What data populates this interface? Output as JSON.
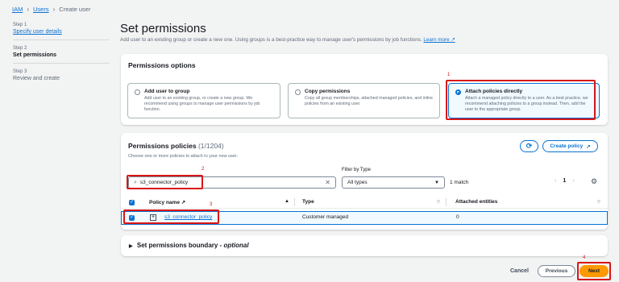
{
  "breadcrumb": {
    "items": [
      "IAM",
      "Users"
    ],
    "current": "Create user"
  },
  "steps": [
    {
      "num": "Step 1",
      "label": "Specify user details"
    },
    {
      "num": "Step 2",
      "label": "Set permissions"
    },
    {
      "num": "Step 3",
      "label": "Review and create"
    }
  ],
  "page": {
    "title": "Set permissions",
    "subtitle": "Add user to an existing group or create a new one. Using groups is a best-practice way to manage user's permissions by job functions.",
    "learn_more": "Learn more"
  },
  "options": {
    "title": "Permissions options",
    "items": [
      {
        "title": "Add user to group",
        "desc": "Add user to an existing group, or create a new group. We recommend using groups to manage user permissions by job function."
      },
      {
        "title": "Copy permissions",
        "desc": "Copy all group memberships, attached managed policies, and inline policies from an existing user."
      },
      {
        "title": "Attach policies directly",
        "desc": "Attach a managed policy directly to a user. As a best practice, we recommend attaching policies to a group instead. Then, add the user to the appropriate group."
      }
    ]
  },
  "policies": {
    "title": "Permissions policies",
    "count": "(1/1204)",
    "desc": "Choose one or more policies to attach to your new user.",
    "refresh_icon": "refresh-icon",
    "create_label": "Create policy",
    "search_value": "s3_connector_policy",
    "filter_label": "Filter by Type",
    "filter_value": "All types",
    "match": "1 match",
    "page": "1",
    "columns": [
      "Policy name",
      "Type",
      "Attached entities"
    ],
    "rows": [
      {
        "name": "s3_connector_policy",
        "type": "Customer managed",
        "entities": "0"
      }
    ]
  },
  "boundary": {
    "title": "Set permissions boundary - ",
    "optional": "optional"
  },
  "footer": {
    "cancel": "Cancel",
    "previous": "Previous",
    "next": "Next"
  },
  "annotations": [
    "1",
    "2",
    "3",
    "4"
  ],
  "colors": {
    "accent": "#0972d3",
    "primary_button": "#ff9900",
    "annotation": "#d91515"
  }
}
